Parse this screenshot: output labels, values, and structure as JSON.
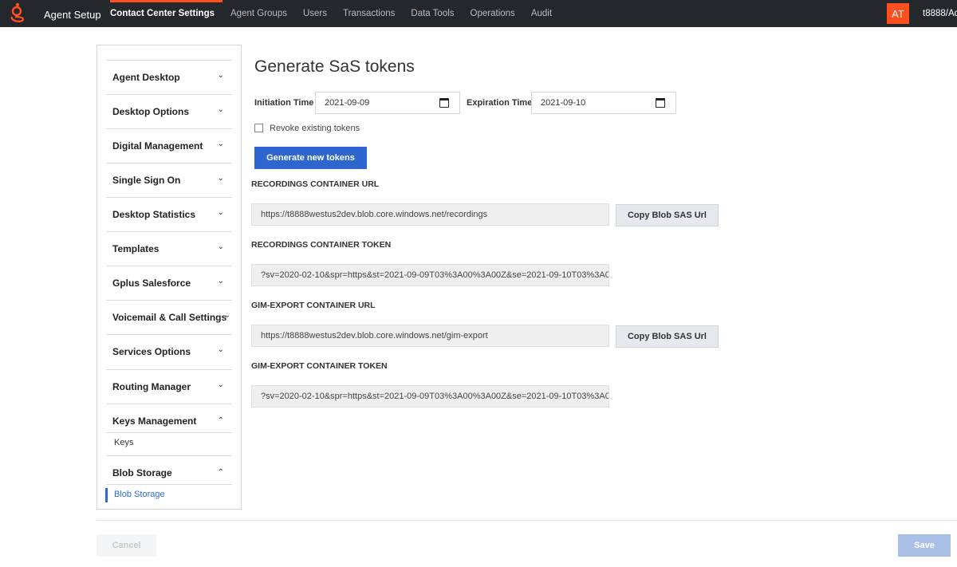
{
  "header": {
    "app_title": "Agent Setup",
    "nav": [
      {
        "label": "Contact Center Settings",
        "active": true
      },
      {
        "label": "Agent Groups"
      },
      {
        "label": "Users"
      },
      {
        "label": "Transactions"
      },
      {
        "label": "Data Tools"
      },
      {
        "label": "Operations"
      },
      {
        "label": "Audit"
      }
    ],
    "avatar_initials": "AT",
    "user_name": "t8888/Ad",
    "accent_color": "#ff4f1f"
  },
  "sidebar": {
    "items": [
      {
        "label": "Agent Desktop",
        "icon": "chevron-down-icon"
      },
      {
        "label": "Desktop Options",
        "icon": "chevron-down-icon"
      },
      {
        "label": "Digital Management",
        "icon": "chevron-down-icon"
      },
      {
        "label": "Single Sign On",
        "icon": "chevron-down-icon"
      },
      {
        "label": "Desktop Statistics",
        "icon": "chevron-down-icon"
      },
      {
        "label": "Templates",
        "icon": "chevron-down-icon"
      },
      {
        "label": "Gplus Salesforce",
        "icon": "chevron-down-icon"
      },
      {
        "label": "Voicemail & Call Settings",
        "icon": "chevron-down-icon"
      },
      {
        "label": "Services Options",
        "icon": "chevron-down-icon"
      },
      {
        "label": "Routing Manager",
        "icon": "chevron-down-icon"
      },
      {
        "label": "Keys Management",
        "icon": "chevron-up-icon"
      },
      {
        "label": "Blob Storage",
        "icon": "chevron-up-icon"
      }
    ],
    "sub_keys": "Keys",
    "sub_blob": "Blob Storage",
    "chev_down": "⌄",
    "chev_up": "⌃"
  },
  "main": {
    "title": "Generate SaS tokens",
    "initiation_label": "Initiation Time",
    "initiation_value": "2021-09-09",
    "expiration_label": "Expiration Time",
    "expiration_value": "2021-09-10",
    "revoke_label": "Revoke existing tokens",
    "revoke_checked": false,
    "generate_label": "Generate new tokens",
    "recordings_url_label": "RECORDINGS CONTAINER URL",
    "recordings_url": "https://t8888westus2dev.blob.core.windows.net/recordings",
    "recordings_token_label": "RECORDINGS CONTAINER TOKEN",
    "recordings_token": "?sv=2020-02-10&spr=https&st=2021-09-09T03%3A00%3A00Z&se=2021-09-10T03%3A00%3...",
    "gim_url_label": "GIM-EXPORT CONTAINER URL",
    "gim_url": "https://t8888westus2dev.blob.core.windows.net/gim-export",
    "gim_token_label": "GIM-EXPORT CONTAINER TOKEN",
    "gim_token": "?sv=2020-02-10&spr=https&st=2021-09-09T03%3A00%3A00Z&se=2021-09-10T03%3A00%3...",
    "copy_label": "Copy Blob SAS Url",
    "primary_color": "#2d66cf"
  },
  "footer": {
    "cancel_label": "Cancel",
    "save_label": "Save"
  }
}
